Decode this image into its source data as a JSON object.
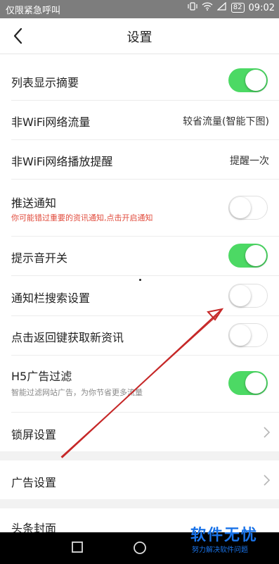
{
  "status_bar": {
    "carrier_text": "仅限紧急呼叫",
    "battery": "82",
    "time": "09:02"
  },
  "header": {
    "title": "设置"
  },
  "rows": [
    {
      "label": "列表显示摘要",
      "control": "toggle",
      "on": true
    },
    {
      "label": "非WiFi网络流量",
      "value": "较省流量(智能下图)"
    },
    {
      "label": "非WiFi网络播放提醒",
      "value": "提醒一次"
    },
    {
      "label": "推送通知",
      "sub": "你可能错过重要的资讯通知,点击开启通知",
      "control": "toggle",
      "on": false
    },
    {
      "label": "提示音开关",
      "control": "toggle",
      "on": true
    },
    {
      "label": "通知栏搜索设置",
      "control": "toggle",
      "on": false
    },
    {
      "label": "点击返回键获取新资讯",
      "control": "toggle",
      "on": false
    },
    {
      "label": "H5广告过滤",
      "sub": "智能过滤网站广告，为你节省更多流量",
      "control": "toggle",
      "on": true
    },
    {
      "label": "锁屏设置",
      "control": "chevron"
    },
    {
      "label": "广告设置",
      "control": "chevron"
    },
    {
      "label": "头条封面"
    }
  ],
  "watermark": {
    "main": "软件无忧",
    "sub": "努力解决软件问题"
  },
  "colors": {
    "toggle_on": "#4cd964",
    "hint_red": "#e14b3c",
    "annotation_arrow": "#c62828"
  }
}
